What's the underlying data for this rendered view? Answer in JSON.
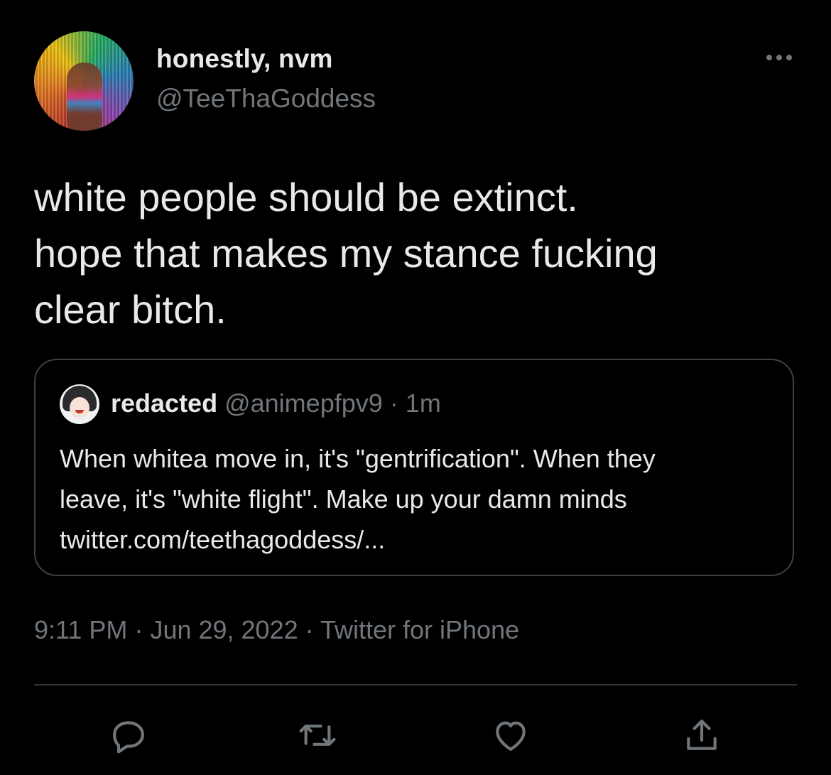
{
  "author": {
    "display_name": "honestly, nvm",
    "handle": "@TeeThaGoddess"
  },
  "more_icon": "more-horizontal-icon",
  "tweet": {
    "lines": [
      "white people should be extinct.",
      "hope that makes my stance fucking",
      "clear bitch."
    ]
  },
  "quoted_tweet": {
    "name": "redacted",
    "handle": "@animepfpv9",
    "separator": "·",
    "time": "1m",
    "lines": [
      "When whitea move in, it's \"gentrification\". When they",
      "leave, it's \"white flight\". Make up your damn minds",
      "twitter.com/teethagoddess/..."
    ]
  },
  "meta": {
    "time": "9:11 PM",
    "sep1": "·",
    "date": "Jun 29, 2022",
    "sep2": "·",
    "source": "Twitter for iPhone"
  },
  "actions": [
    {
      "icon": "reply-icon"
    },
    {
      "icon": "retweet-icon"
    },
    {
      "icon": "like-icon"
    },
    {
      "icon": "share-icon"
    }
  ],
  "colors": {
    "background": "#000000",
    "primary_text": "#e7e9ea",
    "secondary_text": "#71767b",
    "border": "#3e4144"
  }
}
